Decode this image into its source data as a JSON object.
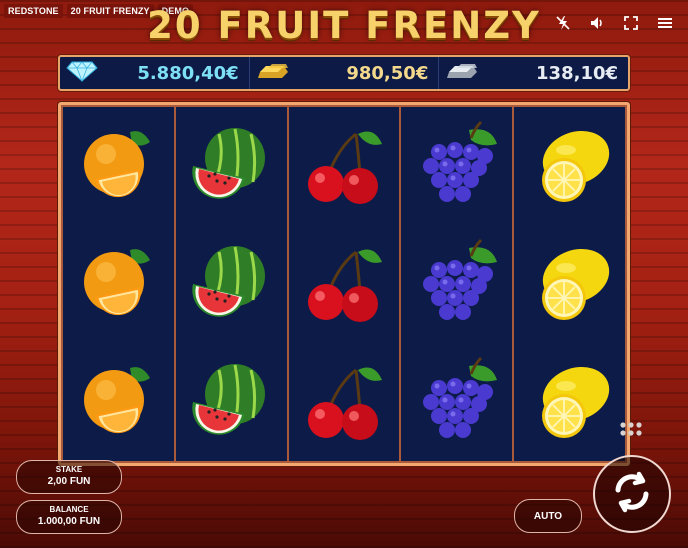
{
  "header": {
    "brand": "REDSTONE",
    "game_name": "20 FRUIT FRENZY",
    "mode": "DEMO",
    "title": "20 FRUIT FRENZY",
    "icons": [
      "lightning-off-icon",
      "volume-icon",
      "fullscreen-icon",
      "menu-icon"
    ]
  },
  "jackpots": [
    {
      "icon": "diamond-icon",
      "value": "5.880,40€"
    },
    {
      "icon": "gold-bar-icon",
      "value": "980,50€"
    },
    {
      "icon": "silver-bar-icon",
      "value": "138,10€"
    }
  ],
  "reels": [
    [
      "orange",
      "orange",
      "orange"
    ],
    [
      "watermelon",
      "watermelon",
      "watermelon"
    ],
    [
      "cherry",
      "cherry",
      "cherry"
    ],
    [
      "grapes",
      "grapes",
      "grapes"
    ],
    [
      "lemon",
      "lemon",
      "lemon"
    ]
  ],
  "controls": {
    "stake_label": "STAKE",
    "stake_value": "2,00 FUN",
    "balance_label": "BALANCE",
    "balance_value": "1.000,00 FUN",
    "auto_label": "AUTO",
    "spin_icon": "spin-arrows-icon",
    "options_icon": "dots-grid-icon"
  },
  "colors": {
    "background": "#a52113",
    "reel_background": "#0d1b48",
    "frame": "#f4a870",
    "title": "#f7d26a",
    "jackpot_diamond": "#7ee0f5",
    "jackpot_gold": "#f4d98d",
    "jackpot_silver": "#e7ecf2"
  }
}
